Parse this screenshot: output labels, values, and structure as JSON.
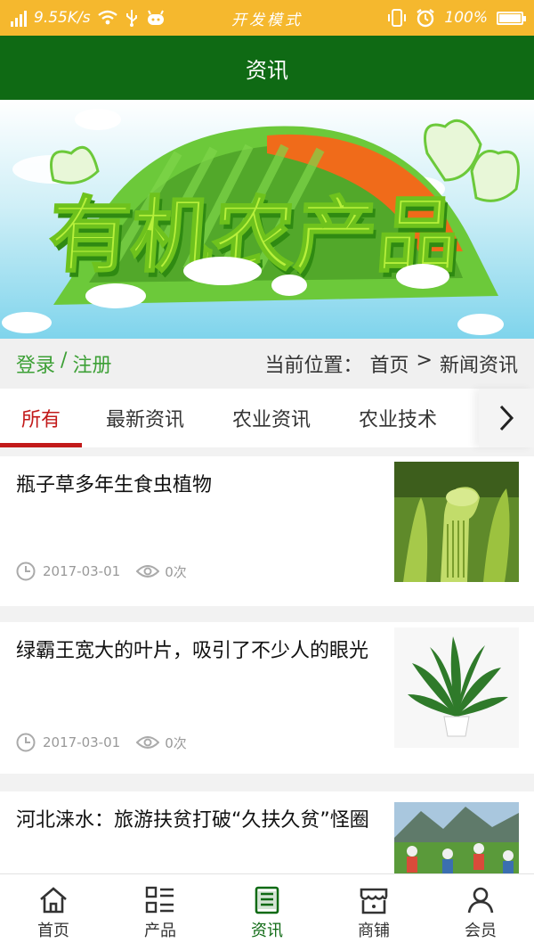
{
  "status_bar": {
    "net_speed": "9.55K/s",
    "mode": "开发模式",
    "battery": "100%",
    "icons": [
      "signal-icon",
      "wifi-icon",
      "usb-icon",
      "android-icon",
      "vibrate-icon",
      "alarm-icon",
      "battery-icon"
    ]
  },
  "header": {
    "title": "资讯"
  },
  "banner": {
    "text": "有机农产品"
  },
  "crumb_bar": {
    "login": "登录",
    "separator": "/",
    "register": "注册",
    "location_label": "当前位置：",
    "home": "首页",
    "arrow": ">",
    "current": "新闻资讯"
  },
  "tabs": [
    {
      "label": "所有",
      "active": true
    },
    {
      "label": "最新资讯",
      "active": false
    },
    {
      "label": "农业资讯",
      "active": false
    },
    {
      "label": "农业技术",
      "active": false
    }
  ],
  "news": [
    {
      "title": "瓶子草多年生食虫植物",
      "date": "2017-03-01",
      "views": "0次"
    },
    {
      "title": "绿霸王宽大的叶片，吸引了不少人的眼光",
      "date": "2017-03-01",
      "views": "0次"
    },
    {
      "title": "河北涞水：旅游扶贫打破“久扶久贫”怪圈"
    }
  ],
  "bottom_nav": [
    {
      "label": "首页",
      "icon": "home-icon"
    },
    {
      "label": "产品",
      "icon": "grid-list-icon"
    },
    {
      "label": "资讯",
      "icon": "news-icon",
      "active": true
    },
    {
      "label": "商铺",
      "icon": "shop-icon"
    },
    {
      "label": "会员",
      "icon": "user-icon"
    }
  ],
  "colors": {
    "status_bar": "#f5b82e",
    "header": "#0f6a14",
    "accent_red": "#c21a1a",
    "login_green": "#3da036"
  }
}
